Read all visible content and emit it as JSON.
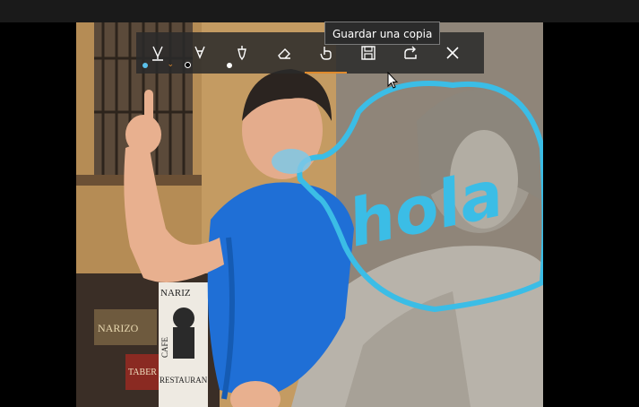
{
  "toolbar": {
    "tools": [
      {
        "name": "ballpoint-pen",
        "dot_color": "#5bc0eb",
        "has_chevron": true
      },
      {
        "name": "pencil",
        "dot_color": "#000000"
      },
      {
        "name": "calligraphy-pen",
        "dot_color": "#ffffff"
      },
      {
        "name": "eraser"
      },
      {
        "name": "touch-writing",
        "active": true
      },
      {
        "name": "save-copy"
      },
      {
        "name": "share"
      },
      {
        "name": "close"
      }
    ],
    "chevron": "⌄",
    "tooltip": "Guardar una copia"
  },
  "photo": {
    "doodle_text": "hola",
    "ink_color": "#3bbde6",
    "sign_texts": {
      "narizo": "NARIZO",
      "narizo_sign": "NARIZ",
      "restaurante": "RESTAURA",
      "cafe": "CAFE",
      "restaurante2": "RESTAURAN",
      "taber": "TABER"
    }
  }
}
